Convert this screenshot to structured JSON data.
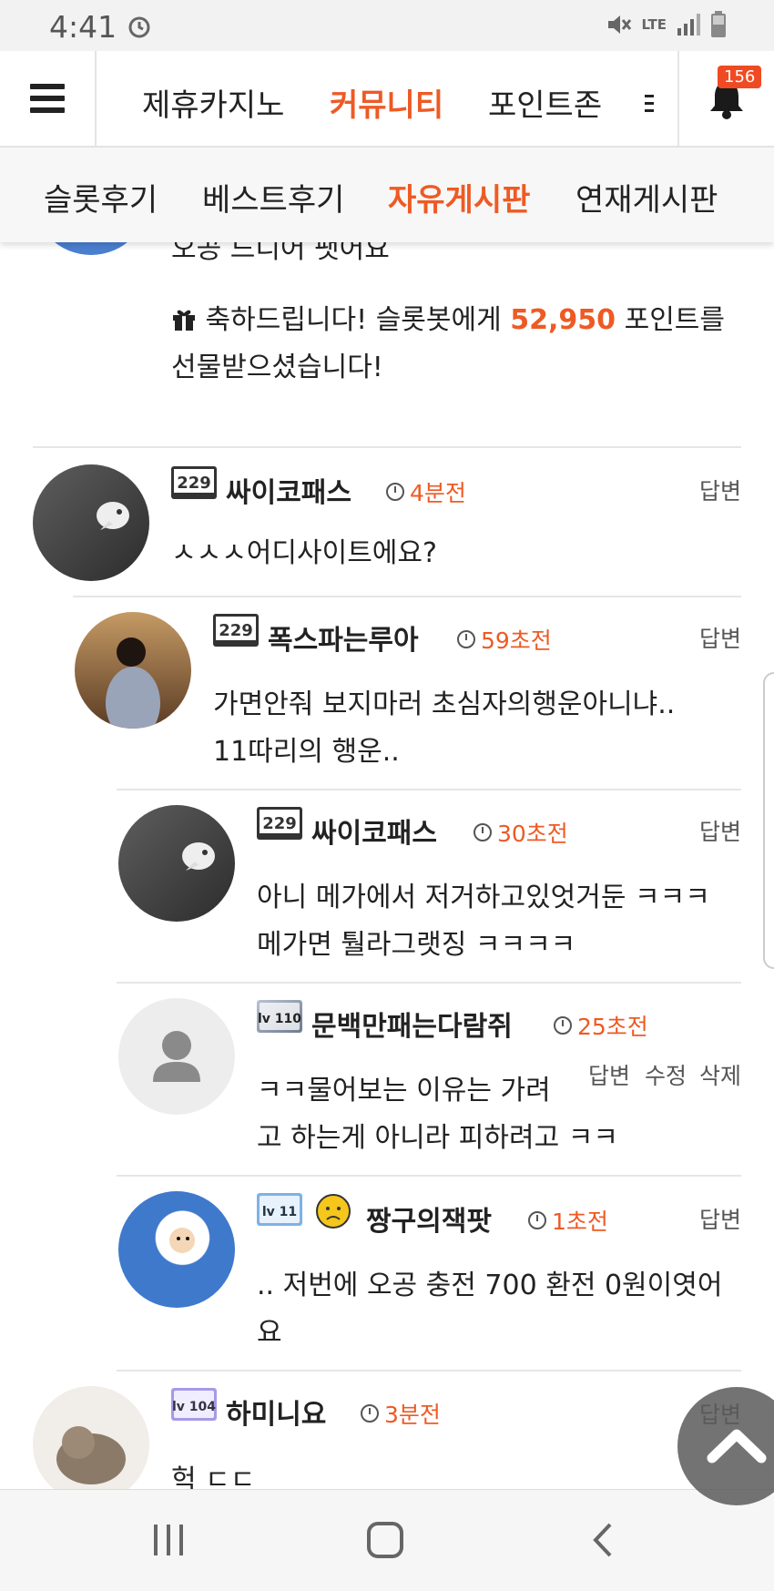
{
  "statusbar": {
    "time": "4:41",
    "network": "LTE"
  },
  "topnav": {
    "items": [
      "제휴카지노",
      "커뮤니티",
      "포인트존"
    ],
    "active": "커뮤니티",
    "notification_count": "156"
  },
  "subnav": {
    "items": [
      "슬롯후기",
      "베스트후기",
      "자유게시판",
      "연재게시판"
    ],
    "active": "자유게시판"
  },
  "first": {
    "text": "오공 드디어 팻어요",
    "gift_pre": "축하드립니다! 슬롯봇에게",
    "gift_points": "52,950",
    "gift_post": "포인트를",
    "gift_line2": "선물받으셨습니다!"
  },
  "comments": [
    {
      "level": "229",
      "nickname": "싸이코패스",
      "time": "4분전",
      "reply": "답변",
      "lines": [
        "ㅅㅅㅅ어디사이트에요?"
      ]
    },
    {
      "level": "229",
      "nickname": "폭스파는루아",
      "time": "59초전",
      "reply": "답변",
      "lines": [
        "가면안줘 보지마러 초심자의행운아니냐..",
        "11따리의 행운.."
      ]
    },
    {
      "level": "229",
      "nickname": "싸이코패스",
      "time": "30초전",
      "reply": "답변",
      "lines": [
        "아니 메가에서 저거하고있엇거둔 ㅋㅋㅋ",
        "메가면 퉐라그랫징 ㅋㅋㅋㅋ"
      ]
    },
    {
      "level": "lv 110",
      "nickname": "문백만패는다람쥐",
      "time": "25초전",
      "actions": [
        "답변",
        "수정",
        "삭제"
      ],
      "lines": [
        "ㅋㅋ물어보는 이유는 가려",
        "고 하는게 아니라 피하려고 ㅋㅋ"
      ]
    },
    {
      "level": "lv 11",
      "nickname": "짱구의잭팟",
      "time": "1초전",
      "reply": "답변",
      "lines": [
        ".. 저번에 오공 충전 700  환전 0원이엿어",
        "요"
      ]
    },
    {
      "level": "lv 104",
      "nickname": "하미니요",
      "time": "3분전",
      "reply": "답변",
      "lines": [
        "헉 ㄷㄷ"
      ]
    }
  ]
}
